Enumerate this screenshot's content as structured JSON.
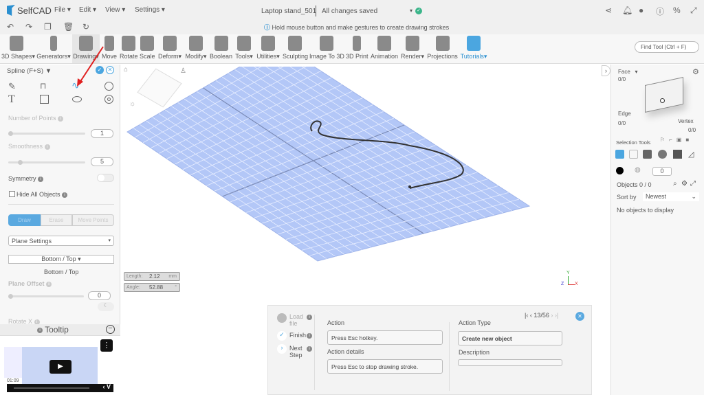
{
  "app": {
    "name": "SelfCAD",
    "menus": [
      "File",
      "Edit",
      "View",
      "Settings"
    ],
    "doc_title": "Laptop stand_501",
    "save_status": "All changes saved"
  },
  "hint": "Hold mouse button and make gestures to create drawing strokes",
  "toolbar": {
    "tools": [
      "3D Shapes",
      "Generators",
      "Drawing",
      "Move",
      "Rotate",
      "Scale",
      "Deform",
      "Modify",
      "Boolean",
      "Tools",
      "Utilities",
      "Sculpting",
      "Image To 3D",
      "3D Print",
      "Animation",
      "Render",
      "Projections",
      "Tutorials"
    ],
    "find_placeholder": "Find Tool (Ctrl + F)"
  },
  "left": {
    "title": "Spline (F+S)",
    "num_points_label": "Number of Points",
    "num_points": "1",
    "smoothness_label": "Smoothness",
    "smoothness": "5",
    "symmetry_label": "Symmetry",
    "hide_label": "Hide All Objects",
    "modes": [
      "Draw",
      "Erase",
      "Move Points"
    ],
    "plane_settings": "Plane Settings",
    "plane_dropdown": "Bottom / Top",
    "plane_text": "Bottom / Top",
    "plane_offset_label": "Plane Offset",
    "plane_offset": "0",
    "rotate_x_label": "Rotate X",
    "tooltip_label": "Tooltip",
    "video_time": "01:09"
  },
  "measure": {
    "length_label": "Length:",
    "length": "2.12",
    "length_unit": "mm",
    "angle_label": "Angle:",
    "angle": "52.88",
    "angle_unit": "°"
  },
  "axes": {
    "x": "X",
    "y": "Y",
    "z": "Z"
  },
  "right": {
    "face": "Face",
    "face_count": "0/0",
    "edge": "Edge",
    "edge_count": "0/0",
    "vertex": "Vertex",
    "vertex_count": "0/0",
    "selection_tools": "Selection Tools",
    "value": "0",
    "objects": "Objects 0 / 0",
    "sort_by": "Sort by",
    "sort_value": "Newest",
    "empty": "No objects to display"
  },
  "steps": {
    "load": "Load file",
    "finish": "Finish",
    "next": "Next Step",
    "pager": "13/56",
    "action_label": "Action",
    "action": "Press Esc hotkey.",
    "details_label": "Action details",
    "details": "Press Esc to stop drawing stroke.",
    "type_label": "Action Type",
    "type": "Create new object",
    "desc_label": "Description",
    "desc": ""
  },
  "colors": {
    "accent": "#2a8fd0",
    "grid": "#b3c7f7",
    "check": "#3bb58a"
  }
}
